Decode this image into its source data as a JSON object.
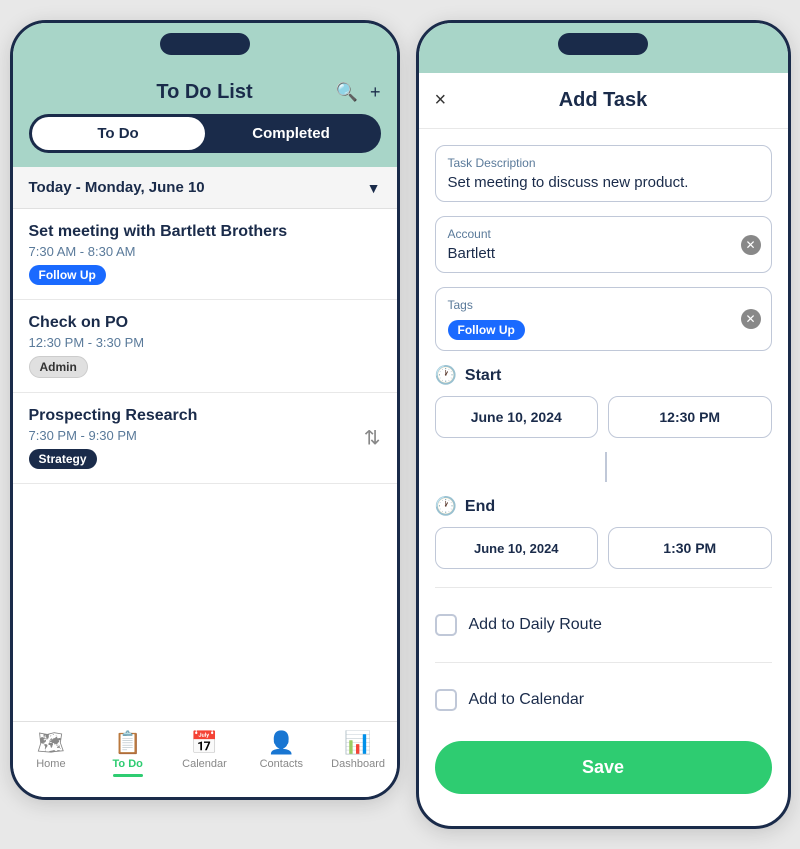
{
  "left_phone": {
    "header": {
      "title": "To Do List",
      "search_icon": "🔍",
      "add_icon": "+"
    },
    "tabs": [
      {
        "label": "To Do",
        "active": true
      },
      {
        "label": "Completed",
        "active": false
      }
    ],
    "date_row": {
      "label": "Today - Monday, June 10",
      "chevron": "▼"
    },
    "tasks": [
      {
        "title": "Set meeting with Bartlett Brothers",
        "time": "7:30 AM - 8:30 AM",
        "tag": "Follow Up",
        "tag_type": "follow-up"
      },
      {
        "title": "Check on PO",
        "time": "12:30 PM - 3:30 PM",
        "tag": "Admin",
        "tag_type": "admin"
      },
      {
        "title": "Prospecting Research",
        "time": "7:30 PM - 9:30 PM",
        "tag": "Strategy",
        "tag_type": "strategy",
        "has_icon": true
      }
    ],
    "bottom_nav": [
      {
        "label": "Home",
        "icon": "🗺",
        "active": false
      },
      {
        "label": "To Do",
        "icon": "📋",
        "active": true
      },
      {
        "label": "Calendar",
        "icon": "📅",
        "active": false
      },
      {
        "label": "Contacts",
        "icon": "👤",
        "active": false
      },
      {
        "label": "Dashboard",
        "icon": "📊",
        "active": false
      }
    ]
  },
  "right_phone": {
    "header": {
      "title": "Add Task",
      "close": "×"
    },
    "form": {
      "task_description_label": "Task Description",
      "task_description_value": "Set meeting to discuss new product.",
      "account_label": "Account",
      "account_value": "Bartlett",
      "tags_label": "Tags",
      "tags_value": "Follow Up",
      "start_label": "Start",
      "start_date": "June 10, 2024",
      "start_time": "12:30 PM",
      "end_label": "End",
      "end_date": "June 10, 2024",
      "end_time": "1:30 PM",
      "add_daily_route": "Add to Daily Route",
      "add_calendar": "Add to Calendar",
      "save_btn": "Save"
    }
  }
}
